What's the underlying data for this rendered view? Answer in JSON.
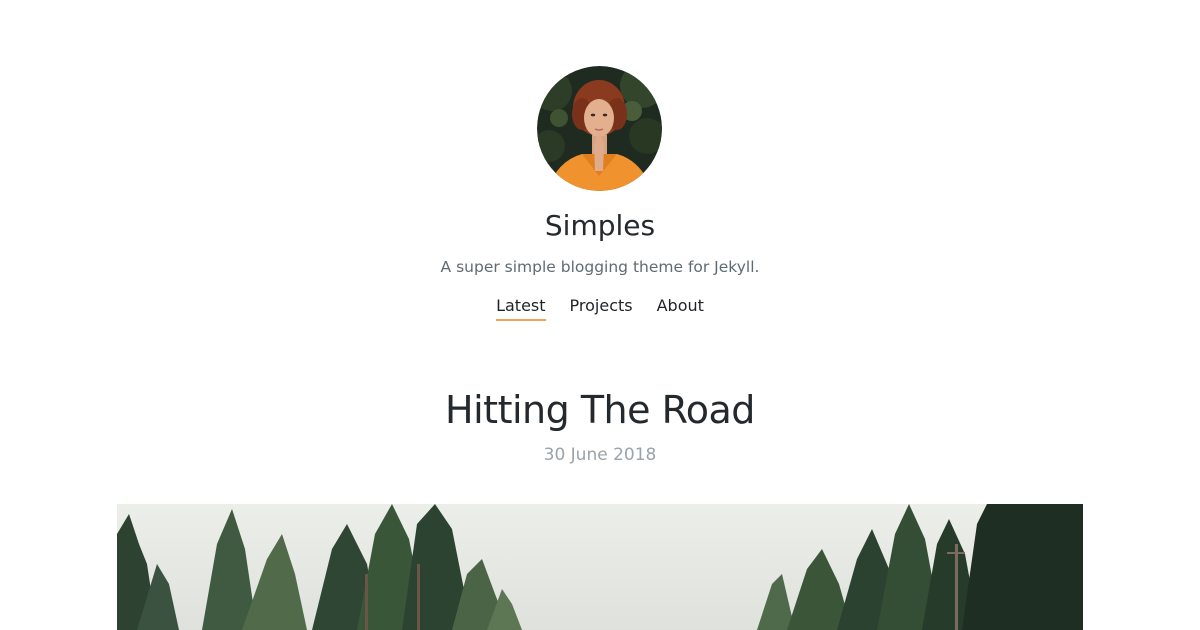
{
  "site": {
    "title": "Simples",
    "description": "A super simple blogging theme for Jekyll."
  },
  "nav": {
    "items": [
      {
        "label": "Latest",
        "active": true
      },
      {
        "label": "Projects",
        "active": false
      },
      {
        "label": "About",
        "active": false
      }
    ]
  },
  "post": {
    "title": "Hitting The Road",
    "date": "30 June 2018"
  },
  "colors": {
    "accent": "#f0a35e",
    "text": "#24292e",
    "muted": "#5f6b73",
    "date": "#9aa3aa"
  }
}
